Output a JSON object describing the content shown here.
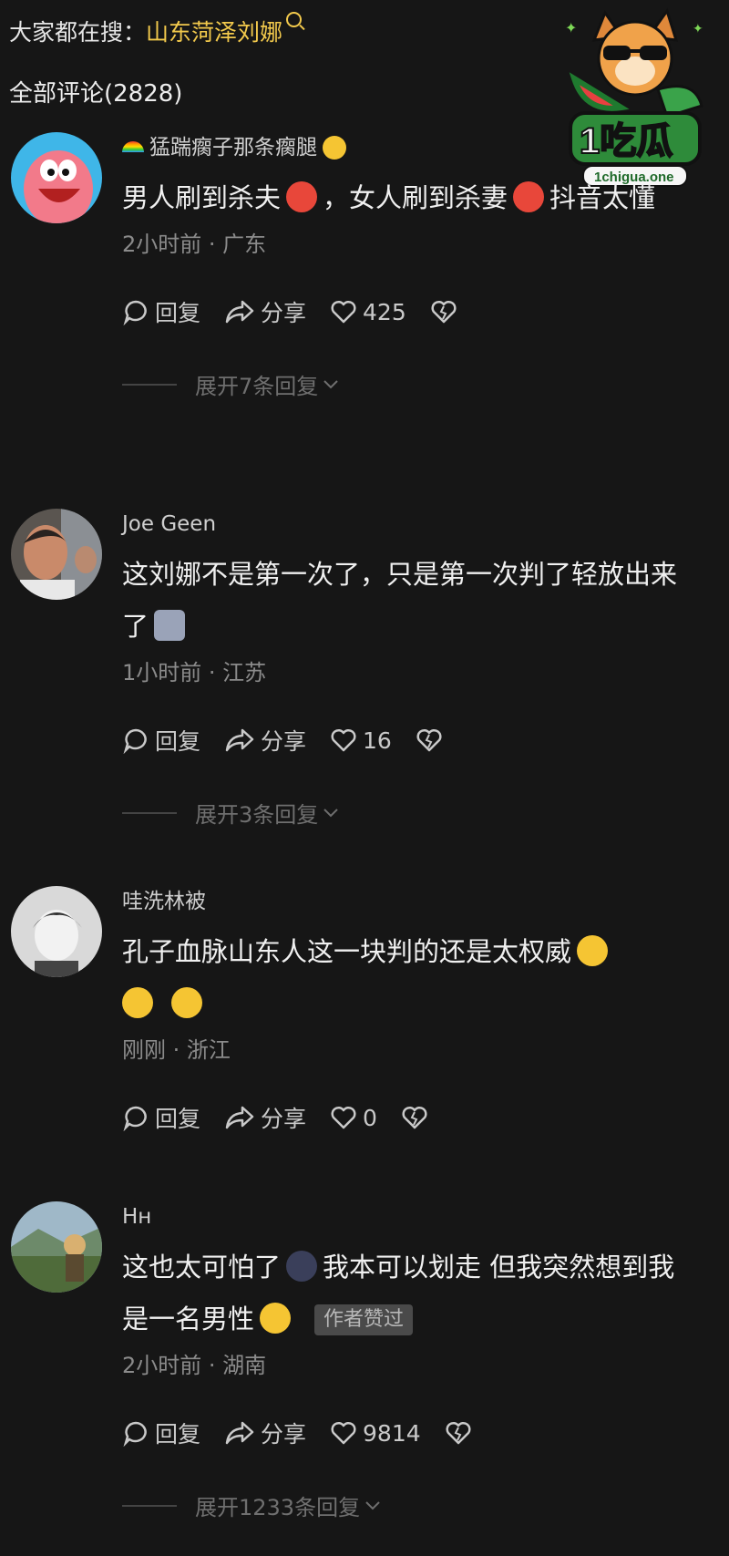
{
  "header": {
    "search_prefix": "大家都在搜：",
    "search_term": "山东菏泽刘娜",
    "comment_count": "全部评论(2828)"
  },
  "logo": {
    "title": "1吃瓜",
    "site": "1chigua.one"
  },
  "action_labels": {
    "reply": "回复",
    "share": "分享"
  },
  "comments": [
    {
      "nick": "猛踹瘸子那条瘸腿",
      "text_a": "男人刷到杀夫",
      "text_b": "，女人刷到杀妻",
      "text_c": "抖音太懂",
      "time_loc": "2小时前 · 广东",
      "likes": "425",
      "expand": "展开7条回复"
    },
    {
      "nick": "Joe Geen",
      "text_a": "这刘娜不是第一次了，只是第一次判了轻放出来了",
      "time_loc": "1小时前 · 江苏",
      "likes": "16",
      "expand": "展开3条回复"
    },
    {
      "nick": "哇洗林被",
      "text_a": "孔子血脉山东人这一块判的还是太权威",
      "time_loc": "刚刚 · 浙江",
      "likes": "0"
    },
    {
      "nick": "Hн",
      "text_a": "这也太可怕了",
      "text_b": "我本可以划走 但我突然想到我是一名男性",
      "badge": "作者赞过",
      "time_loc": "2小时前 · 湖南",
      "likes": "9814",
      "expand": "展开1233条回复"
    }
  ],
  "colors": {
    "background": "#161616",
    "hot_search": "#f2c94c",
    "muted": "#8b8b8b"
  }
}
